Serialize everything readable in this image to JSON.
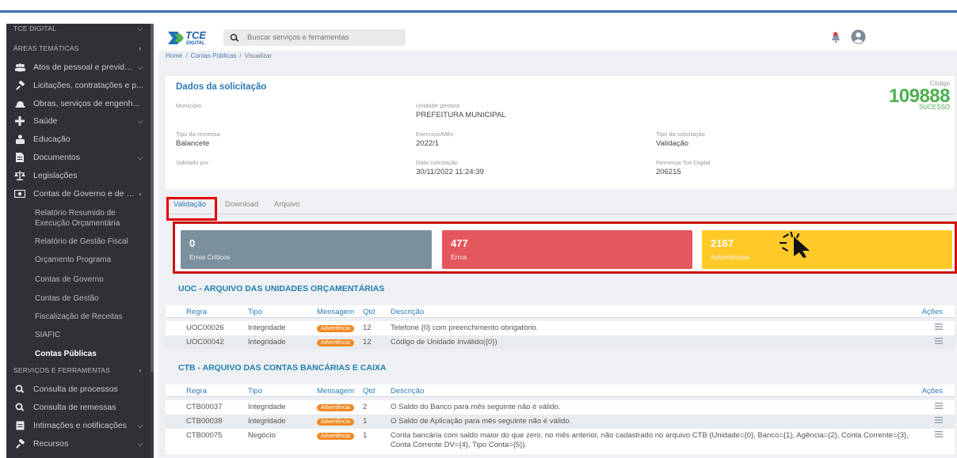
{
  "sidebar": {
    "headers": {
      "tce_digital": "TCE DIGITAL",
      "areas": "ÁREAS TEMÁTICAS",
      "servicos": "SERVIÇOS E FERRAMENTAS"
    },
    "items": [
      {
        "label": "Atos de pessoal e previdên...",
        "icon": "people-icon"
      },
      {
        "label": "Licitações, contratações e p...",
        "icon": "gavel-icon"
      },
      {
        "label": "Obras, serviços de engenh...",
        "icon": "hardhat-icon"
      },
      {
        "label": "Saúde",
        "icon": "plus-icon"
      },
      {
        "label": "Educação",
        "icon": "education-icon"
      },
      {
        "label": "Documentos",
        "icon": "document-icon"
      },
      {
        "label": "Legislações",
        "icon": "balance-icon"
      },
      {
        "label": "Contas de Governo e de Ge...",
        "icon": "money-icon"
      }
    ],
    "subitems": [
      "Relatório Resumido de Execução Orçamentária",
      "Relatório de Gestão Fiscal",
      "Orçamento Programa",
      "Contas de Governo",
      "Contas de Gestão",
      "Fiscalização de Receitas",
      "SIAFIC",
      "Contas Públicas"
    ],
    "tools": [
      {
        "label": "Consulta de processos",
        "icon": "search-icon"
      },
      {
        "label": "Consulta de remessas",
        "icon": "search-icon"
      },
      {
        "label": "Intimações e notificações",
        "icon": "document-icon"
      },
      {
        "label": "Recursos",
        "icon": "gavel-icon"
      }
    ]
  },
  "topbar": {
    "logo_text": "TCE",
    "logo_sub": "DIGITAL",
    "search_placeholder": "Buscar serviços e ferramentas"
  },
  "breadcrumb": {
    "home": "Home",
    "sep": "/",
    "section": "Contas Públicas",
    "current": "Visualizar"
  },
  "request": {
    "title": "Dados da solicitação",
    "codigo_label": "Código",
    "codigo": "109888",
    "status": "SUCESSO",
    "fields": {
      "municipio": {
        "label": "Município",
        "value": ""
      },
      "unidade": {
        "label": "Unidade gestora",
        "value": "PREFEITURA MUNICIPAL"
      },
      "tipo_remessa": {
        "label": "Tipo da remessa",
        "value": "Balancete"
      },
      "exercicio": {
        "label": "Exercício/Mês",
        "value": "2022/1"
      },
      "tipo_solicitacao": {
        "label": "Tipo da solicitação",
        "value": "Validação"
      },
      "validado": {
        "label": "Validado por",
        "value": ""
      },
      "data": {
        "label": "Data solicitação",
        "value": "30/11/2022 11:24:39"
      },
      "remessa": {
        "label": "Remessa Tce-Digital",
        "value": "206215"
      }
    }
  },
  "tabs": [
    "Validação",
    "Download",
    "Arquivo"
  ],
  "summary": {
    "criticos": {
      "value": "0",
      "label": "Erros Críticos"
    },
    "erros": {
      "value": "477",
      "label": "Erros"
    },
    "advertencias": {
      "value": "2167",
      "label": "Advertências"
    }
  },
  "columns": {
    "regra": "Regra",
    "tipo": "Tipo",
    "mensagem": "Mensagem",
    "qtd": "Qtd",
    "descricao": "Descrição",
    "acoes": "Ações"
  },
  "sections": [
    {
      "title": "UOC - ARQUIVO DAS UNIDADES ORÇAMENTÁRIAS",
      "rows": [
        {
          "regra": "UOC00026",
          "tipo": "Integridade",
          "mensagem": "Advertência",
          "qtd": "12",
          "descricao": "Telefone {0} com preenchimento obrigatório."
        },
        {
          "regra": "UOC00042",
          "tipo": "Integridade",
          "mensagem": "Advertência",
          "qtd": "12",
          "descricao": "Código de Unidade Inválido({0})"
        }
      ]
    },
    {
      "title": "CTB - ARQUIVO DAS CONTAS BANCÁRIAS E CAIXA",
      "rows": [
        {
          "regra": "CTB00037",
          "tipo": "Integridade",
          "mensagem": "Advertência",
          "qtd": "2",
          "descricao": "O Saldo do Banco para mês seguinte não é válido."
        },
        {
          "regra": "CTB00038",
          "tipo": "Integridade",
          "mensagem": "Advertência",
          "qtd": "1",
          "descricao": "O Saldo de Aplicação para mês seguinte não é válido."
        },
        {
          "regra": "CTB00075",
          "tipo": "Negócio",
          "mensagem": "Advertência",
          "qtd": "1",
          "descricao": "Conta bancária com saldo maior do que zero, no mês anterior, não cadastrado no arquivo CTB (Unidade={0}, Banco={1}, Agência={2}, Conta Corrente={3}, Conta Corrente DV={4}, Tipo Conta={5})."
        }
      ]
    }
  ],
  "colors": {
    "accent": "#2b7cb5",
    "success": "#4caf50",
    "grey_box": "#7a919d",
    "red_box": "#e4575d",
    "yellow_box": "#ffca28",
    "badge": "#f08a24",
    "highlight": "#e00000"
  }
}
